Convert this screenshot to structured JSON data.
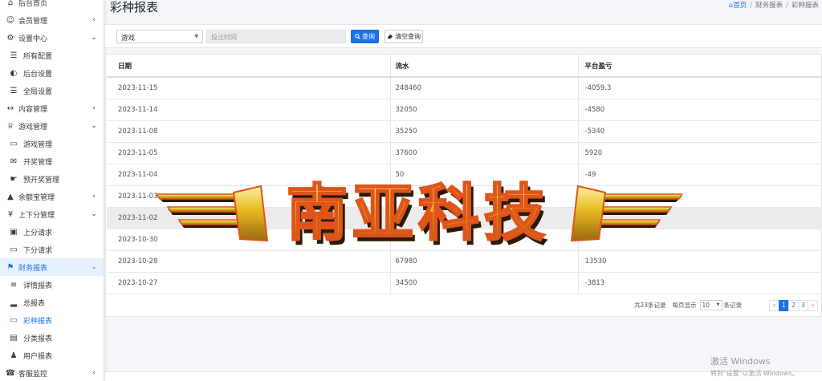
{
  "sidebar": {
    "items": [
      {
        "label": "后台首页",
        "icon": "home-icon",
        "glyph": "⌂",
        "sub": false,
        "chevron": ""
      },
      {
        "label": "会员管理",
        "icon": "users-icon",
        "glyph": "☺",
        "sub": false,
        "chevron": "‹"
      },
      {
        "label": "设置中心",
        "icon": "cogs-icon",
        "glyph": "⚙",
        "sub": false,
        "chevron": "⌄"
      },
      {
        "label": "所有配置",
        "icon": "list-icon",
        "glyph": "☰",
        "sub": true,
        "chevron": ""
      },
      {
        "label": "后台设置",
        "icon": "adjust-icon",
        "glyph": "◐",
        "sub": true,
        "chevron": ""
      },
      {
        "label": "全局设置",
        "icon": "list-icon",
        "glyph": "☰",
        "sub": true,
        "chevron": ""
      },
      {
        "label": "内容管理",
        "icon": "expand-icon",
        "glyph": "↔",
        "sub": false,
        "chevron": "‹"
      },
      {
        "label": "游戏管理",
        "icon": "trophy-icon",
        "glyph": "♕",
        "sub": false,
        "chevron": "⌄"
      },
      {
        "label": "游戏管理",
        "icon": "gamepad-icon",
        "glyph": "▭",
        "sub": true,
        "chevron": ""
      },
      {
        "label": "开奖管理",
        "icon": "envelope-open-icon",
        "glyph": "✉",
        "sub": true,
        "chevron": ""
      },
      {
        "label": "预开奖管理",
        "icon": "hand-icon",
        "glyph": "☛",
        "sub": true,
        "chevron": ""
      },
      {
        "label": "余额宝管理",
        "icon": "piggy-bank-icon",
        "glyph": "▲",
        "sub": false,
        "chevron": "‹"
      },
      {
        "label": "上下分管理",
        "icon": "payment-icon",
        "glyph": "¥",
        "sub": false,
        "chevron": "⌄"
      },
      {
        "label": "上分请求",
        "icon": "money-bill-icon",
        "glyph": "▣",
        "sub": true,
        "chevron": ""
      },
      {
        "label": "下分请求",
        "icon": "credit-card-icon",
        "glyph": "▭",
        "sub": true,
        "chevron": ""
      },
      {
        "label": "财务报表",
        "icon": "flag-icon",
        "glyph": "⚑",
        "sub": false,
        "chevron": "⌄"
      },
      {
        "label": "详情报表",
        "icon": "bars-icon",
        "glyph": "≡",
        "sub": true,
        "chevron": ""
      },
      {
        "label": "总报表",
        "icon": "signal-icon",
        "glyph": "▂",
        "sub": true,
        "chevron": ""
      },
      {
        "label": "彩种报表",
        "icon": "gamepad-icon",
        "glyph": "▭",
        "sub": true,
        "chevron": ""
      },
      {
        "label": "分类报表",
        "icon": "id-card-icon",
        "glyph": "▤",
        "sub": true,
        "chevron": ""
      },
      {
        "label": "用户报表",
        "icon": "user-secret-icon",
        "glyph": "♟",
        "sub": true,
        "chevron": ""
      },
      {
        "label": "客服监控",
        "icon": "headset-icon",
        "glyph": "☎",
        "sub": false,
        "chevron": "‹"
      }
    ]
  },
  "header": {
    "title": "彩种报表",
    "breadcrumb": [
      "首页",
      "财务报表",
      "彩种报表"
    ]
  },
  "filter": {
    "game_select_value": "游戏",
    "time_placeholder": "投注时间",
    "search_label": "查询",
    "clear_label": "清空查询"
  },
  "table": {
    "columns": [
      "日期",
      "流水",
      "平台盈亏"
    ],
    "rows": [
      [
        "2023-11-15",
        "248460",
        "-4059.3"
      ],
      [
        "2023-11-14",
        "32050",
        "-4580"
      ],
      [
        "2023-11-08",
        "35250",
        "-5340"
      ],
      [
        "2023-11-05",
        "37600",
        "5920"
      ],
      [
        "2023-11-04",
        "50",
        "-49"
      ],
      [
        "2023-11-03",
        "",
        ""
      ],
      [
        "2023-11-02",
        "",
        ""
      ],
      [
        "2023-10-30",
        "",
        ""
      ],
      [
        "2023-10-28",
        "67980",
        "13530"
      ],
      [
        "2023-10-27",
        "34500",
        "-3813"
      ]
    ]
  },
  "pagination": {
    "total_text": "共23条记录",
    "per_page_label": "每页显示",
    "per_page_value": "10",
    "per_page_suffix": "条记录",
    "prev": "«",
    "pages": [
      "1",
      "2",
      "3"
    ],
    "next": "»",
    "current": "1"
  },
  "overlay": {
    "logo_text": "南亚科技"
  },
  "windows_watermark": {
    "title": "激活 Windows",
    "subtitle": "转到\"设置\"以激活 Windows。"
  },
  "colors": {
    "accent": "#1a73e8",
    "logo_gold": "#e8b820",
    "logo_orange": "#e0541a"
  }
}
